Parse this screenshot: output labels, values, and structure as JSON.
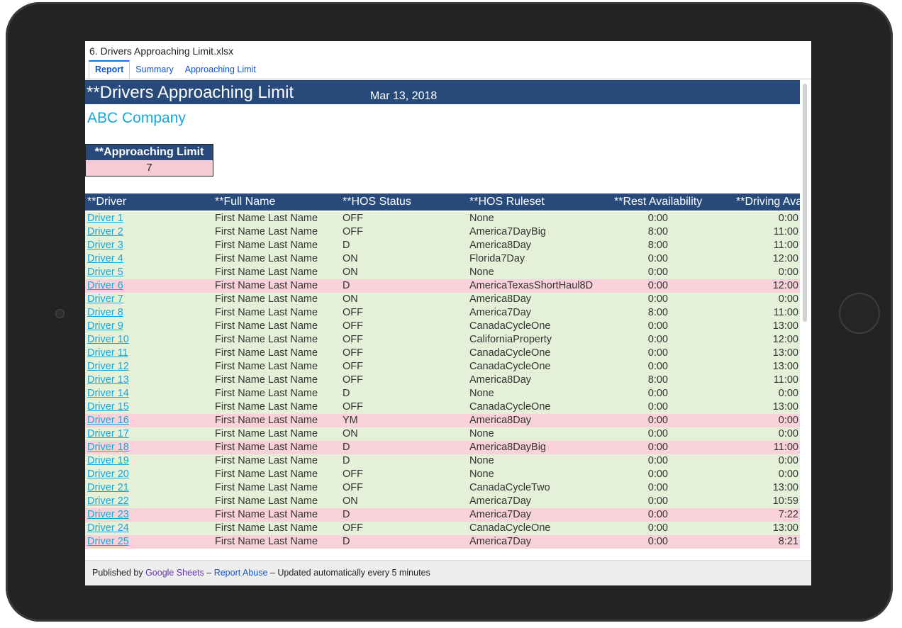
{
  "file_title": "6. Drivers Approaching Limit.xlsx",
  "tabs": [
    {
      "label": "Report",
      "active": true
    },
    {
      "label": "Summary",
      "active": false
    },
    {
      "label": "Approaching Limit",
      "active": false
    }
  ],
  "report": {
    "title": "**Drivers Approaching Limit",
    "date": "Mar 13, 2018",
    "company": "ABC Company",
    "approaching_label": "**Approaching Limit",
    "approaching_value": "7"
  },
  "table": {
    "columns": [
      "**Driver",
      "**Full Name",
      "**HOS Status",
      "**HOS Ruleset",
      "**Rest Availability",
      "**Driving Ava"
    ],
    "rows": [
      {
        "driver": "Driver 1",
        "name": "First Name Last Name",
        "status": "OFF",
        "ruleset": "None",
        "rest": "0:00",
        "drive": "0:00",
        "hl": false
      },
      {
        "driver": "Driver 2",
        "name": "First Name Last Name",
        "status": "OFF",
        "ruleset": "America7DayBig",
        "rest": "8:00",
        "drive": "11:00",
        "hl": false
      },
      {
        "driver": "Driver 3",
        "name": "First Name Last Name",
        "status": "D",
        "ruleset": "America8Day",
        "rest": "8:00",
        "drive": "11:00",
        "hl": false
      },
      {
        "driver": "Driver 4",
        "name": "First Name Last Name",
        "status": "ON",
        "ruleset": "Florida7Day",
        "rest": "0:00",
        "drive": "12:00",
        "hl": false
      },
      {
        "driver": "Driver 5",
        "name": "First Name Last Name",
        "status": "ON",
        "ruleset": "None",
        "rest": "0:00",
        "drive": "0:00",
        "hl": false
      },
      {
        "driver": "Driver 6",
        "name": "First Name Last Name",
        "status": "D",
        "ruleset": "AmericaTexasShortHaul8D",
        "rest": "0:00",
        "drive": "12:00",
        "hl": true
      },
      {
        "driver": "Driver 7",
        "name": "First Name Last Name",
        "status": "ON",
        "ruleset": "America8Day",
        "rest": "0:00",
        "drive": "0:00",
        "hl": false
      },
      {
        "driver": "Driver 8",
        "name": "First Name Last Name",
        "status": "OFF",
        "ruleset": "America7Day",
        "rest": "8:00",
        "drive": "11:00",
        "hl": false
      },
      {
        "driver": "Driver 9",
        "name": "First Name Last Name",
        "status": "OFF",
        "ruleset": "CanadaCycleOne",
        "rest": "0:00",
        "drive": "13:00",
        "hl": false
      },
      {
        "driver": "Driver 10",
        "name": "First Name Last Name",
        "status": "OFF",
        "ruleset": "CaliforniaProperty",
        "rest": "0:00",
        "drive": "12:00",
        "hl": false
      },
      {
        "driver": "Driver 11",
        "name": "First Name Last Name",
        "status": "OFF",
        "ruleset": "CanadaCycleOne",
        "rest": "0:00",
        "drive": "13:00",
        "hl": false
      },
      {
        "driver": "Driver 12",
        "name": "First Name Last Name",
        "status": "OFF",
        "ruleset": "CanadaCycleOne",
        "rest": "0:00",
        "drive": "13:00",
        "hl": false
      },
      {
        "driver": "Driver 13",
        "name": "First Name Last Name",
        "status": "OFF",
        "ruleset": "America8Day",
        "rest": "8:00",
        "drive": "11:00",
        "hl": false
      },
      {
        "driver": "Driver 14",
        "name": "First Name Last Name",
        "status": "D",
        "ruleset": "None",
        "rest": "0:00",
        "drive": "0:00",
        "hl": false
      },
      {
        "driver": "Driver 15",
        "name": "First Name Last Name",
        "status": "OFF",
        "ruleset": "CanadaCycleOne",
        "rest": "0:00",
        "drive": "13:00",
        "hl": false
      },
      {
        "driver": "Driver 16",
        "name": "First Name Last Name",
        "status": "YM",
        "ruleset": "America8Day",
        "rest": "0:00",
        "drive": "0:00",
        "hl": true
      },
      {
        "driver": "Driver 17",
        "name": "First Name Last Name",
        "status": "ON",
        "ruleset": "None",
        "rest": "0:00",
        "drive": "0:00",
        "hl": false
      },
      {
        "driver": "Driver 18",
        "name": "First Name Last Name",
        "status": "D",
        "ruleset": "America8DayBig",
        "rest": "0:00",
        "drive": "11:00",
        "hl": true
      },
      {
        "driver": "Driver 19",
        "name": "First Name Last Name",
        "status": "D",
        "ruleset": "None",
        "rest": "0:00",
        "drive": "0:00",
        "hl": false
      },
      {
        "driver": "Driver 20",
        "name": "First Name Last Name",
        "status": "OFF",
        "ruleset": "None",
        "rest": "0:00",
        "drive": "0:00",
        "hl": false
      },
      {
        "driver": "Driver 21",
        "name": "First Name Last Name",
        "status": "OFF",
        "ruleset": "CanadaCycleTwo",
        "rest": "0:00",
        "drive": "13:00",
        "hl": false
      },
      {
        "driver": "Driver 22",
        "name": "First Name Last Name",
        "status": "ON",
        "ruleset": "America7Day",
        "rest": "0:00",
        "drive": "10:59",
        "hl": false
      },
      {
        "driver": "Driver 23",
        "name": "First Name Last Name",
        "status": "D",
        "ruleset": "America7Day",
        "rest": "0:00",
        "drive": "7:22",
        "hl": true
      },
      {
        "driver": "Driver 24",
        "name": "First Name Last Name",
        "status": "OFF",
        "ruleset": "CanadaCycleOne",
        "rest": "0:00",
        "drive": "13:00",
        "hl": false
      },
      {
        "driver": "Driver 25",
        "name": "First Name Last Name",
        "status": "D",
        "ruleset": "America7Day",
        "rest": "0:00",
        "drive": "8:21",
        "hl": true
      }
    ]
  },
  "footer": {
    "published_by": "Published by",
    "google_sheets": "Google Sheets",
    "sep1": "–",
    "report_abuse": "Report Abuse",
    "sep2": "–",
    "updated": "Updated automatically every 5 minutes"
  },
  "colors": {
    "header_bg": "#274a7a",
    "row_green": "#e4f0d8",
    "row_pink": "#f8d1da",
    "link": "#16a8dc"
  }
}
